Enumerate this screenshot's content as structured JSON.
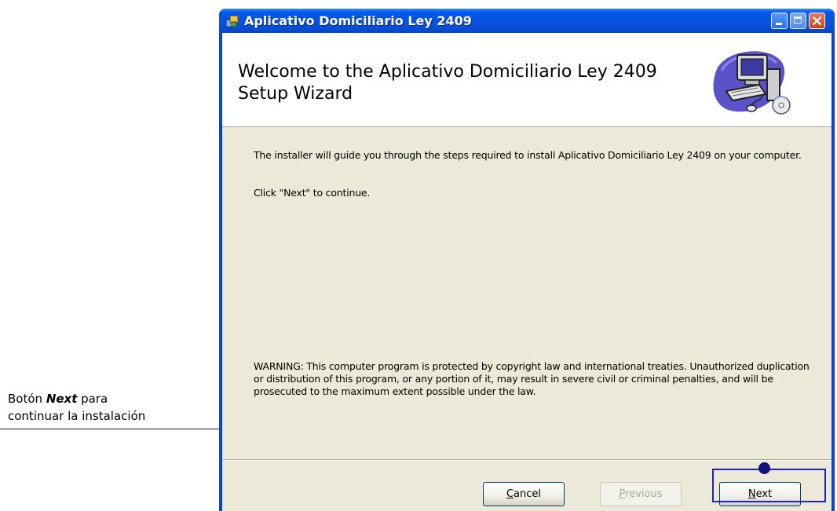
{
  "annotation": {
    "line1_prefix": "Botón ",
    "line1_emphasis": "Next",
    "line1_suffix": " para",
    "line2": "continuar la instalación"
  },
  "window": {
    "title": "Aplicativo Domiciliario Ley 2409"
  },
  "banner": {
    "title": "Welcome to the Aplicativo Domiciliario Ley 2409 Setup Wizard"
  },
  "content": {
    "intro": "The installer will guide you through the steps required to install Aplicativo Domiciliario Ley 2409 on your computer.",
    "instruction": "Click \"Next\" to continue.",
    "warning": "WARNING: This computer program is protected by copyright law and international treaties. Unauthorized duplication or distribution of this program, or any portion of it, may result in severe civil or criminal penalties, and will be prosecuted to the maximum extent possible under the law."
  },
  "buttons": {
    "cancel": {
      "mnemonic": "C",
      "rest": "ancel",
      "enabled": true
    },
    "previous": {
      "mnemonic": "P",
      "rest": "revious",
      "enabled": false
    },
    "next": {
      "mnemonic": "N",
      "rest": "ext",
      "enabled": true
    }
  },
  "colors": {
    "titlebar": "#0058ee",
    "client_bg": "#ece9d8",
    "annotation_line": "#1a1aa8",
    "close_button": "#c94422"
  }
}
